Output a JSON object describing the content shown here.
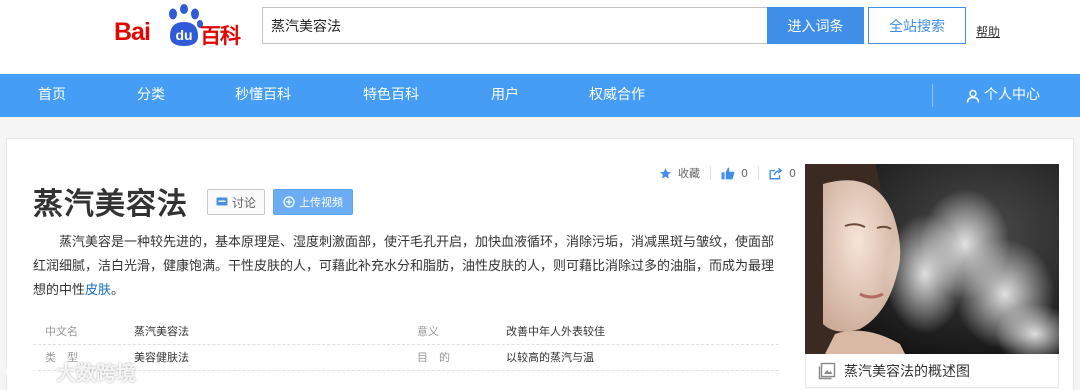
{
  "header": {
    "logo": {
      "bai": "Bai",
      "du": "du",
      "baike": "百科"
    },
    "search": {
      "value": "蒸汽美容法"
    },
    "enter_button": "进入词条",
    "site_button": "全站搜索",
    "help": "帮助"
  },
  "nav": {
    "items": [
      "首页",
      "分类",
      "秒懂百科",
      "特色百科",
      "用户",
      "权威合作"
    ],
    "user_center": "个人中心"
  },
  "article": {
    "title": "蒸汽美容法",
    "discuss_label": "讨论",
    "upload_label": "上传视频",
    "favorite_label": "收藏",
    "like_count": "0",
    "share_count": "0",
    "desc_text": "蒸汽美容是一种较先进的，基本原理是、湿度刺激面部，使汗毛孔开启，加快血液循环，消除污垢，消减黑斑与皱纹，使面部红润细腻，洁白光滑，健康饱满。干性皮肤的人，可藉此补充水分和脂肪，油性皮肤的人，则可藉比消除过多的油脂，而成为最理想的中性",
    "desc_link": "皮肤",
    "desc_end": "。"
  },
  "info": [
    {
      "k1": "中文名",
      "v1": "蒸汽美容法",
      "k2": "意义",
      "v2": "改善中年人外表较佳"
    },
    {
      "k1": "类　型",
      "v1": "美容健肤法",
      "k2": "目　的",
      "v2": "以较高的蒸汽与温"
    }
  ],
  "summary": {
    "caption": "蒸汽美容法的概述图"
  },
  "watermark": "大数跨境",
  "colors": {
    "brand_red": "#e10602",
    "nav_blue": "#459df5",
    "button_blue": "#3f8ee8",
    "link_blue": "#136ec2"
  }
}
